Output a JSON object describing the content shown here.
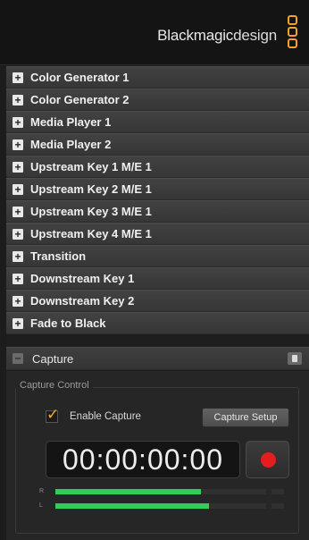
{
  "brand": {
    "text_bold": "Blackmagic",
    "text_light": "design"
  },
  "sections": [
    {
      "label": "Color Generator 1"
    },
    {
      "label": "Color Generator 2"
    },
    {
      "label": "Media Player 1"
    },
    {
      "label": "Media Player 2"
    },
    {
      "label": "Upstream Key 1 M/E 1"
    },
    {
      "label": "Upstream Key 2 M/E 1"
    },
    {
      "label": "Upstream Key 3 M/E 1"
    },
    {
      "label": "Upstream Key 4 M/E 1"
    },
    {
      "label": "Transition"
    },
    {
      "label": "Downstream Key 1"
    },
    {
      "label": "Downstream Key 2"
    },
    {
      "label": "Fade to Black"
    }
  ],
  "capture": {
    "title": "Capture",
    "group_title": "Capture Control",
    "enable_label": "Enable Capture",
    "enable_checked": true,
    "setup_label": "Capture Setup",
    "timecode": "00:00:00:00",
    "meters": [
      {
        "channel": "R",
        "level": 0.69
      },
      {
        "channel": "L",
        "level": 0.73
      }
    ]
  },
  "colors": {
    "accent": "#f2a12a",
    "record": "#e41e1e",
    "meter": "#2fd05a"
  }
}
